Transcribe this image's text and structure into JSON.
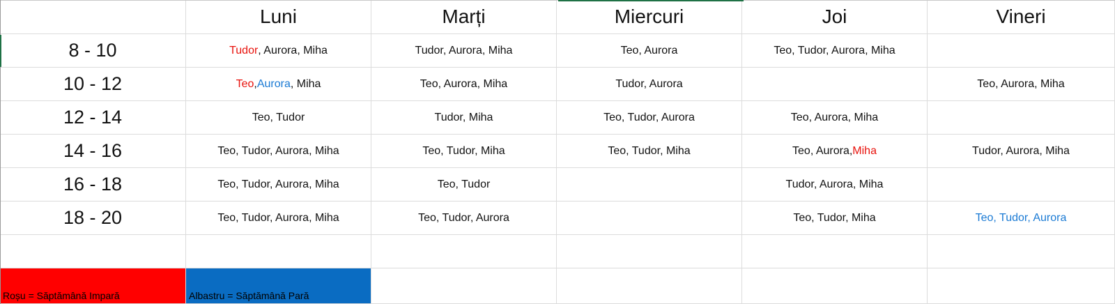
{
  "days": [
    "Luni",
    "Marți",
    "Miercuri",
    "Joi",
    "Vineri"
  ],
  "rows": [
    {
      "time": "8 - 10",
      "cells": [
        [
          {
            "t": "Tudor",
            "c": "red"
          },
          {
            "t": ", Aurora, Miha"
          }
        ],
        [
          {
            "t": "Tudor, Aurora, Miha"
          }
        ],
        [
          {
            "t": "Teo, Aurora"
          }
        ],
        [
          {
            "t": "Teo, Tudor, Aurora, Miha"
          }
        ],
        []
      ]
    },
    {
      "time": "10 - 12",
      "cells": [
        [
          {
            "t": "Teo",
            "c": "red"
          },
          {
            "t": ", "
          },
          {
            "t": "Aurora",
            "c": "blue"
          },
          {
            "t": ", Miha"
          }
        ],
        [
          {
            "t": "Teo, Aurora, Miha"
          }
        ],
        [
          {
            "t": "Tudor, Aurora"
          }
        ],
        [],
        [
          {
            "t": "Teo, Aurora, Miha"
          }
        ]
      ]
    },
    {
      "time": "12 - 14",
      "cells": [
        [
          {
            "t": "Teo, Tudor"
          }
        ],
        [
          {
            "t": "Tudor, Miha"
          }
        ],
        [
          {
            "t": "Teo, Tudor, Aurora"
          }
        ],
        [
          {
            "t": "Teo, Aurora, Miha"
          }
        ],
        []
      ]
    },
    {
      "time": "14 - 16",
      "cells": [
        [
          {
            "t": "Teo, Tudor, Aurora, Miha"
          }
        ],
        [
          {
            "t": "Teo, Tudor, Miha"
          }
        ],
        [
          {
            "t": "Teo, Tudor, Miha"
          }
        ],
        [
          {
            "t": "Teo, Aurora, "
          },
          {
            "t": "Miha",
            "c": "red"
          }
        ],
        [
          {
            "t": "Tudor, Aurora, Miha"
          }
        ]
      ]
    },
    {
      "time": "16 - 18",
      "cells": [
        [
          {
            "t": "Teo, Tudor, Aurora, Miha"
          }
        ],
        [
          {
            "t": "Teo, Tudor"
          }
        ],
        [],
        [
          {
            "t": "Tudor, Aurora, Miha"
          }
        ],
        []
      ]
    },
    {
      "time": "18 - 20",
      "cells": [
        [
          {
            "t": "Teo, Tudor, Aurora, Miha"
          }
        ],
        [
          {
            "t": "Teo, Tudor, Aurora"
          }
        ],
        [],
        [
          {
            "t": "Teo, Tudor, Miha"
          }
        ],
        [
          {
            "t": "Teo, Tudor, Aurora",
            "c": "blue"
          }
        ]
      ]
    }
  ],
  "legend": {
    "odd_label": "Roșu = Săptămână Impară",
    "even_label": "Albastru =  Săptămână Pară"
  },
  "colors": {
    "red": "#ff0000",
    "blue": "#0a6cc2",
    "selection": "#1e7145"
  }
}
